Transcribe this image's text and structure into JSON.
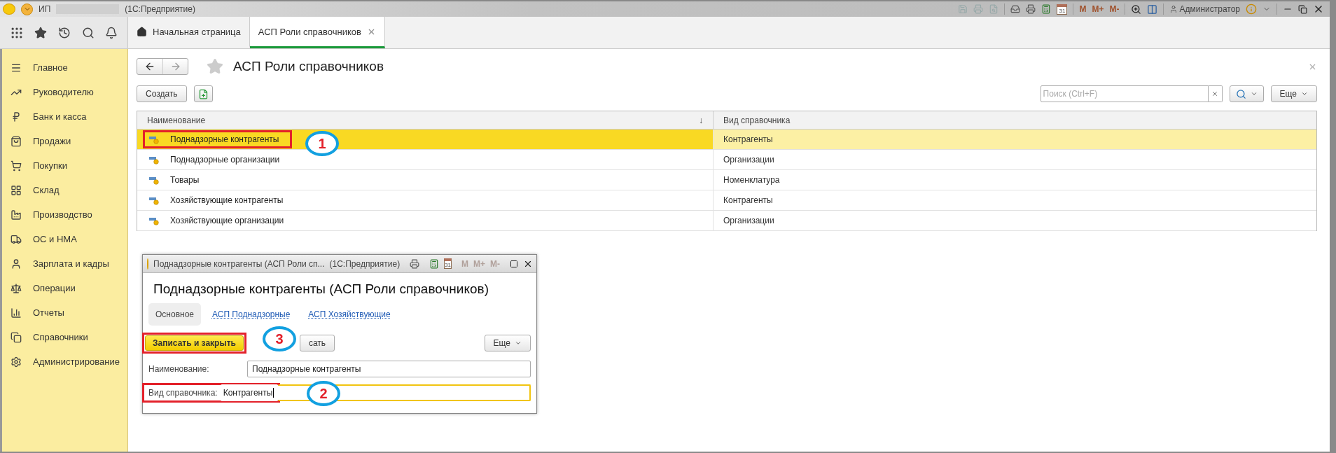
{
  "title_bar": {
    "app_label": "ИП",
    "app_name": "(1С:Предприятие)",
    "calendar_day": "31",
    "memory_keys": [
      "M",
      "M+",
      "M-"
    ],
    "user": "Администратор"
  },
  "tabs": [
    {
      "label": "Начальная страница",
      "selected": false
    },
    {
      "label": "АСП Роли справочников",
      "selected": true
    }
  ],
  "sidebar": {
    "items": [
      {
        "label": "Главное"
      },
      {
        "label": "Руководителю"
      },
      {
        "label": "Банк и касса"
      },
      {
        "label": "Продажи"
      },
      {
        "label": "Покупки"
      },
      {
        "label": "Склад"
      },
      {
        "label": "Производство"
      },
      {
        "label": "ОС и НМА"
      },
      {
        "label": "Зарплата и кадры"
      },
      {
        "label": "Операции"
      },
      {
        "label": "Отчеты"
      },
      {
        "label": "Справочники"
      },
      {
        "label": "Администрирование"
      }
    ]
  },
  "page": {
    "title": "АСП Роли справочников",
    "create_button": "Создать",
    "search": {
      "placeholder": "Поиск (Ctrl+F)"
    },
    "more_button": "Еще",
    "table": {
      "columns": [
        "Наименование",
        "Вид справочника"
      ],
      "sort_mark": "↓",
      "rows": [
        {
          "name": "Поднадзорные контрагенты",
          "catalog_kind": "Контрагенты",
          "selected": true,
          "highlighted": true
        },
        {
          "name": "Поднадзорные организации",
          "catalog_kind": "Организации",
          "selected": false,
          "highlighted": false
        },
        {
          "name": "Товары",
          "catalog_kind": "Номенклатура",
          "selected": false,
          "highlighted": false
        },
        {
          "name": "Хозяйствующие контрагенты",
          "catalog_kind": "Контрагенты",
          "selected": false,
          "highlighted": false
        },
        {
          "name": "Хозяйствующие организации",
          "catalog_kind": "Организации",
          "selected": false,
          "highlighted": false
        }
      ]
    }
  },
  "dialog": {
    "title": "Поднадзорные контрагенты (АСП Роли сп...",
    "app_name": "(1С:Предприятие)",
    "calendar_day": "31",
    "memory_keys": [
      "M",
      "M+",
      "M-"
    ],
    "heading": "Поднадзорные контрагенты (АСП Роли справочников)",
    "tabs": [
      {
        "label": "Основное",
        "selected": true
      },
      {
        "label": "АСП Поднадзорные",
        "selected": false
      },
      {
        "label": "АСП Хозяйствующие",
        "selected": false
      }
    ],
    "save_close_button": {
      "label": "Записать и закрыть",
      "highlighted": true
    },
    "save_button": "сать",
    "more_button": "Еще",
    "fields": [
      {
        "label": "Наименование:",
        "value": "Поднадзорные контрагенты",
        "focused": false,
        "highlighted": false
      },
      {
        "label": "Вид справочника:",
        "value": "Контрагенты",
        "focused": true,
        "highlighted": true
      }
    ]
  },
  "annotations": [
    {
      "number": "1"
    },
    {
      "number": "2"
    },
    {
      "number": "3"
    }
  ]
}
